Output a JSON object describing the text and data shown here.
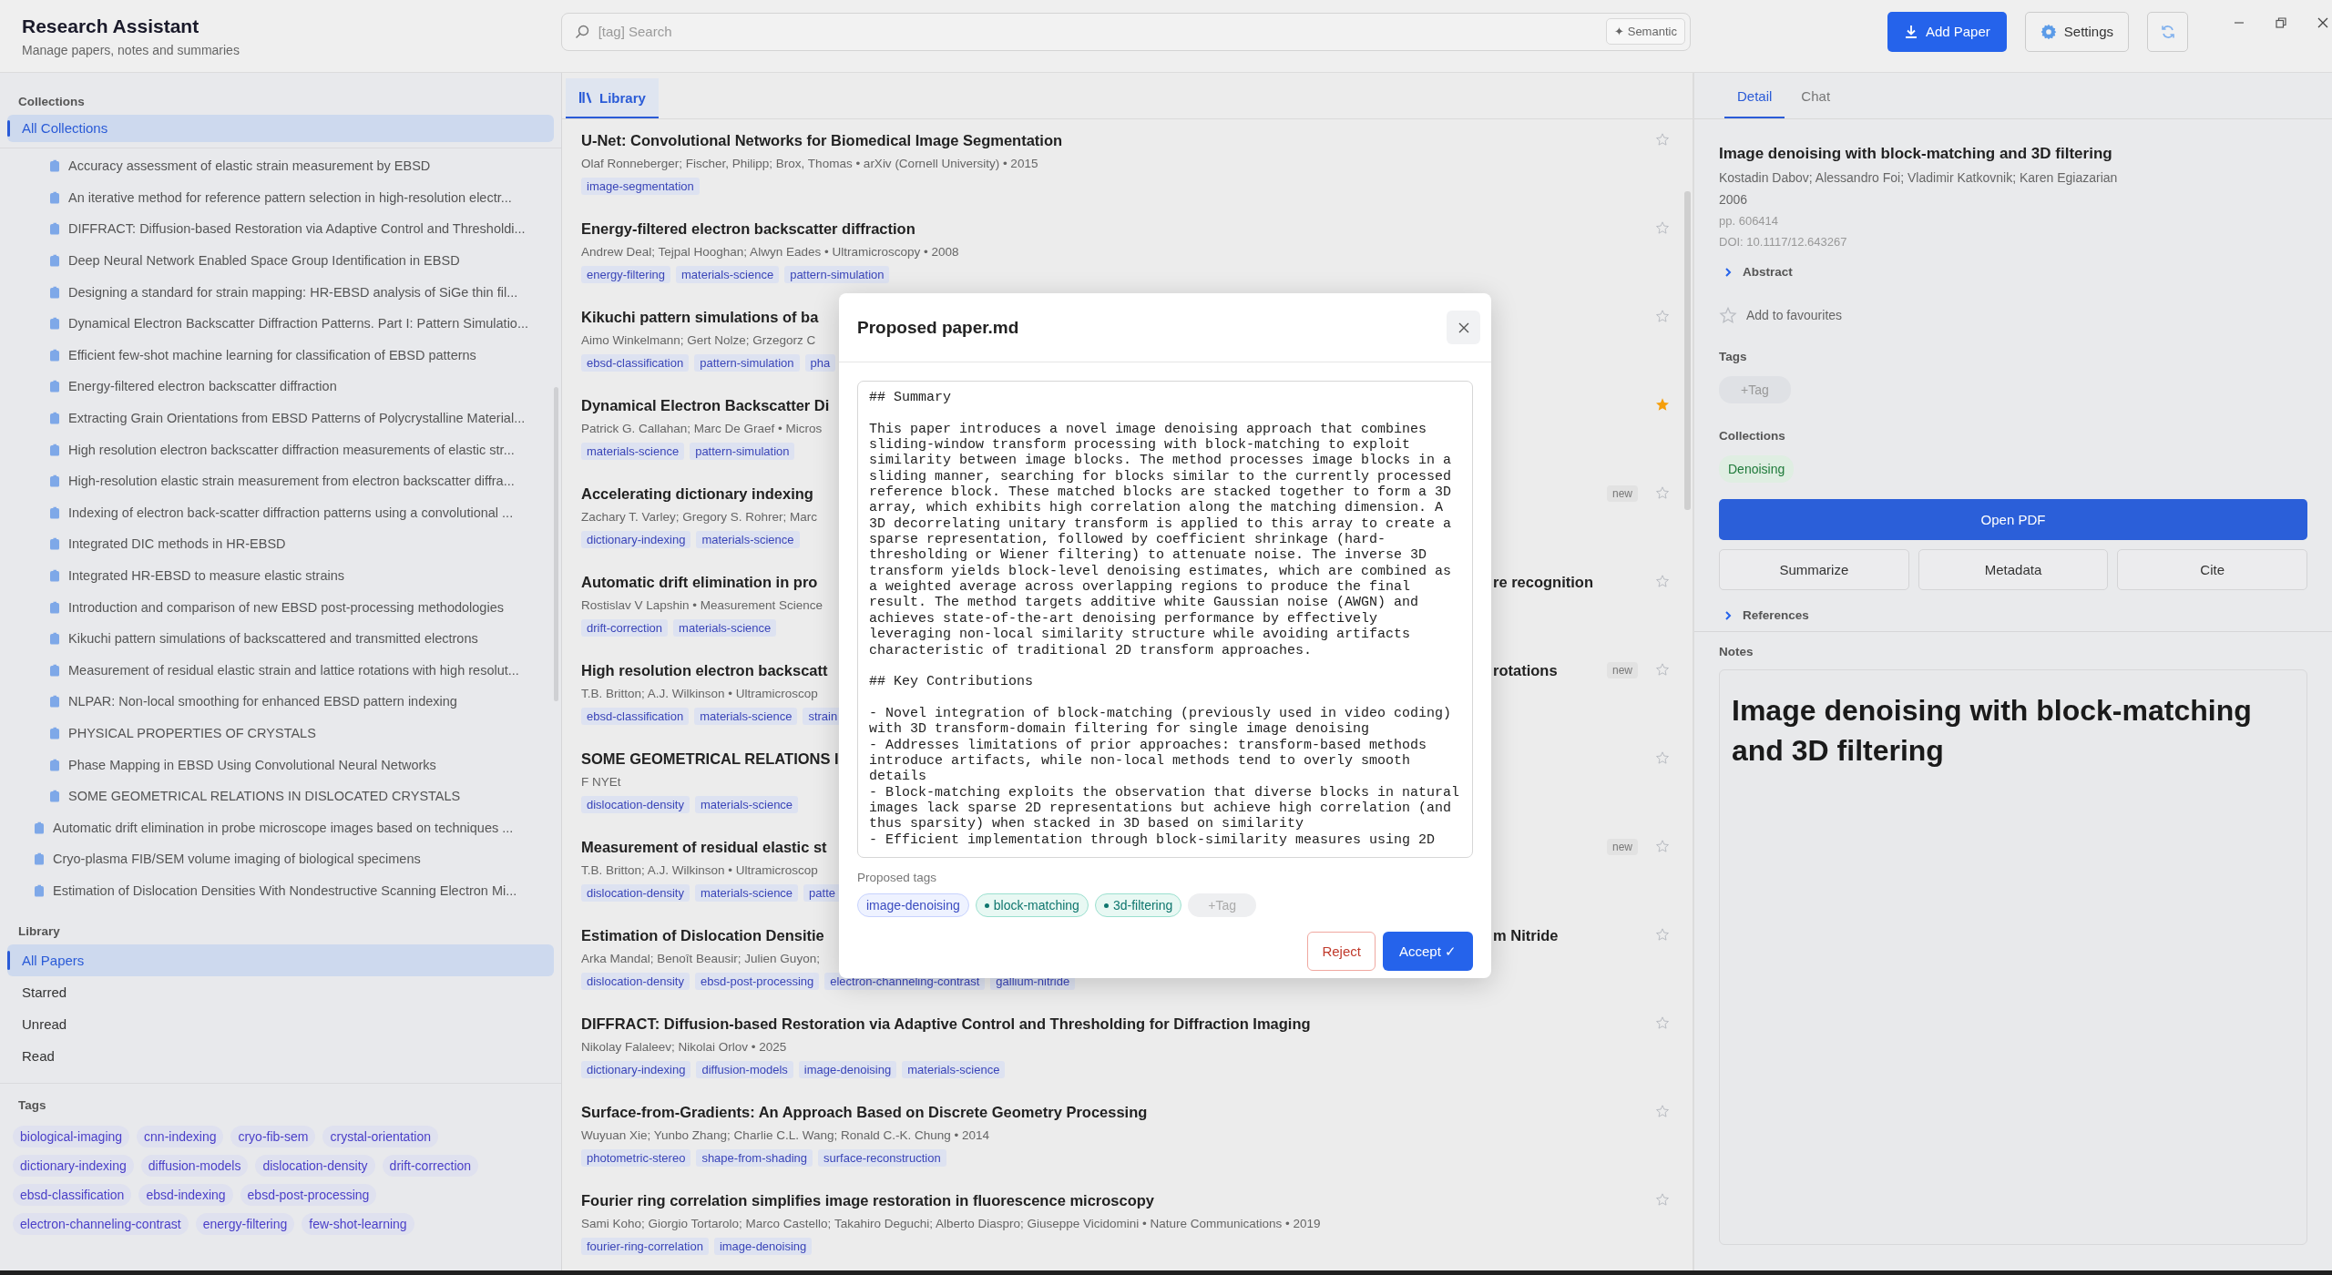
{
  "app": {
    "title": "Research Assistant",
    "subtitle": "Manage papers, notes and summaries"
  },
  "search": {
    "placeholder": "[tag] Search",
    "mode_button": "✦ Semantic"
  },
  "toolbar": {
    "add_paper": "Add Paper",
    "settings": "Settings"
  },
  "sidebar": {
    "collections_heading": "Collections",
    "all_collections": {
      "label": "All Collections",
      "selected": true
    },
    "collection_tree": [
      {
        "children": [
          {
            "label": "Accuracy assessment of elastic strain measurement by EBSD"
          },
          {
            "label": "An iterative method for reference pattern selection in high-resolution electr..."
          },
          {
            "label": "DIFFRACT: Diffusion-based Restoration via Adaptive Control and Thresholdi..."
          },
          {
            "label": "Deep Neural Network Enabled Space Group Identification in EBSD"
          },
          {
            "label": "Designing a standard for strain mapping: HR-EBSD analysis of SiGe thin fil..."
          },
          {
            "label": "Dynamical Electron Backscatter Diffraction Patterns. Part I: Pattern Simulatio..."
          },
          {
            "label": "Efficient few-shot machine learning for classification of EBSD patterns"
          },
          {
            "label": "Energy-filtered electron backscatter diffraction"
          },
          {
            "label": "Extracting Grain Orientations from EBSD Patterns of Polycrystalline Material..."
          },
          {
            "label": "High resolution electron backscatter diffraction measurements of elastic str..."
          },
          {
            "label": "High-resolution elastic strain measurement from electron backscatter diffra..."
          },
          {
            "label": "Indexing of electron back-scatter diffraction patterns using a convolutional ..."
          },
          {
            "label": "Integrated DIC methods in HR-EBSD"
          },
          {
            "label": "Integrated HR-EBSD to measure elastic strains"
          },
          {
            "label": "Introduction and comparison of new EBSD post-processing methodologies"
          },
          {
            "label": "Kikuchi pattern simulations of backscattered and transmitted electrons"
          },
          {
            "label": "Measurement of residual elastic strain and lattice rotations with high resolut..."
          },
          {
            "label": "NLPAR: Non-local smoothing for enhanced EBSD pattern indexing"
          },
          {
            "label": "PHYSICAL PROPERTIES OF CRYSTALS"
          },
          {
            "label": "Phase Mapping in EBSD Using Convolutional Neural Networks"
          },
          {
            "label": "SOME GEOMETRICAL RELATIONS IN DISLOCATED CRYSTALS"
          }
        ]
      },
      {
        "label": "Automatic drift elimination in probe microscope images based on techniques ..."
      },
      {
        "label": "Cryo-plasma FIB/SEM volume imaging of biological specimens"
      },
      {
        "label": "Estimation of Dislocation Densities With Nondestructive Scanning Electron Mi..."
      }
    ],
    "library_heading": "Library",
    "library_items": [
      {
        "label": "All Papers",
        "selected": true
      },
      {
        "label": "Starred",
        "selected": false
      },
      {
        "label": "Unread",
        "selected": false
      },
      {
        "label": "Read",
        "selected": false
      }
    ],
    "tags_heading": "Tags",
    "tags": [
      "biological-imaging",
      "cnn-indexing",
      "cryo-fib-sem",
      "crystal-orientation",
      "dictionary-indexing",
      "diffusion-models",
      "dislocation-density",
      "drift-correction",
      "ebsd-classification",
      "ebsd-indexing",
      "ebsd-post-processing",
      "electron-channeling-contrast",
      "energy-filtering",
      "few-shot-learning"
    ]
  },
  "library_tab": {
    "label": "Library",
    "selected": true
  },
  "papers": [
    {
      "title": "U-Net: Convolutional Networks for Biomedical Image Segmentation",
      "meta": "Olaf Ronneberger; Fischer, Philipp; Brox, Thomas • arXiv (Cornell University) • 2015",
      "tags": [
        "image-segmentation"
      ],
      "starred": false
    },
    {
      "title": "Energy-filtered electron backscatter diffraction",
      "meta": "Andrew Deal; Tejpal Hooghan; Alwyn Eades • Ultramicroscopy • 2008",
      "tags": [
        "energy-filtering",
        "materials-science",
        "pattern-simulation"
      ],
      "starred": false
    },
    {
      "title": "Kikuchi pattern simulations of ba",
      "meta": "Aimo Winkelmann; Gert Nolze; Grzegorz C",
      "tags": [
        "ebsd-classification",
        "pattern-simulation",
        "pha"
      ],
      "starred": false
    },
    {
      "title": "Dynamical Electron Backscatter Di",
      "meta": "Patrick G. Callahan; Marc De Graef • Micros",
      "tags": [
        "materials-science",
        "pattern-simulation"
      ],
      "starred": true
    },
    {
      "title": "Accelerating dictionary indexing",
      "meta": "Zachary T. Varley; Gregory S. Rohrer; Marc",
      "tags": [
        "dictionary-indexing",
        "materials-science"
      ],
      "badge": "new",
      "starred": false
    },
    {
      "title": "Automatic drift elimination in pro",
      "title_tail": "re recognition",
      "meta": "Rostislav V Lapshin • Measurement Science",
      "tags": [
        "drift-correction",
        "materials-science"
      ],
      "starred": false
    },
    {
      "title": "High resolution electron backscatt",
      "title_tail": "rotations",
      "meta": "T.B. Britton; A.J. Wilkinson • Ultramicroscop",
      "tags": [
        "ebsd-classification",
        "materials-science",
        "strain"
      ],
      "badge": "new",
      "starred": false
    },
    {
      "title": "SOME GEOMETRICAL RELATIONS I",
      "meta": "F NYEt",
      "tags": [
        "dislocation-density",
        "materials-science"
      ],
      "starred": false
    },
    {
      "title": "Measurement of residual elastic st",
      "meta": "T.B. Britton; A.J. Wilkinson • Ultramicroscop",
      "tags": [
        "dislocation-density",
        "materials-science",
        "patte"
      ],
      "badge": "new",
      "starred": false
    },
    {
      "title": "Estimation of Dislocation Densitie",
      "title_tail": "m Nitride",
      "meta": "Arka Mandal; Benoît Beausir; Julien Guyon;",
      "tags": [
        "dislocation-density",
        "ebsd-post-processing",
        "electron-channeling-contrast",
        "gallium-nitride"
      ],
      "starred": false
    },
    {
      "title": "DIFFRACT: Diffusion-based Restoration via Adaptive Control and Thresholding for Diffraction Imaging",
      "meta": "Nikolay Falaleev; Nikolai Orlov • 2025",
      "tags": [
        "dictionary-indexing",
        "diffusion-models",
        "image-denoising",
        "materials-science"
      ],
      "starred": false
    },
    {
      "title": "Surface-from-Gradients: An Approach Based on Discrete Geometry Processing",
      "meta": "Wuyuan Xie; Yunbo Zhang; Charlie C.L. Wang; Ronald C.-K. Chung • 2014",
      "tags": [
        "photometric-stereo",
        "shape-from-shading",
        "surface-reconstruction"
      ],
      "starred": false
    },
    {
      "title": "Fourier ring correlation simplifies image restoration in fluorescence microscopy",
      "meta": "Sami Koho; Giorgio Tortarolo; Marco Castello; Takahiro Deguchi; Alberto Diaspro; Giuseppe Vicidomini • Nature Communications • 2019",
      "tags": [
        "fourier-ring-correlation",
        "image-denoising"
      ],
      "starred": false
    }
  ],
  "modal": {
    "title": "Proposed paper.md",
    "content": "## Summary\n\nThis paper introduces a novel image denoising approach that combines sliding-window transform processing with block-matching to exploit similarity between image blocks. The method processes image blocks in a sliding manner, searching for blocks similar to the currently processed reference block. These matched blocks are stacked together to form a 3D array, which exhibits high correlation along the matching dimension. A 3D decorrelating unitary transform is applied to this array to create a sparse representation, followed by coefficient shrinkage (hard-thresholding or Wiener filtering) to attenuate noise. The inverse 3D transform yields block-level denoising estimates, which are combined as a weighted average across overlapping regions to produce the final result. The method targets additive white Gaussian noise (AWGN) and achieves state-of-the-art denoising performance by effectively leveraging non-local similarity structure while avoiding artifacts characteristic of traditional 2D transform approaches.\n\n## Key Contributions\n\n- Novel integration of block-matching (previously used in video coding) with 3D transform-domain filtering for single image denoising\n- Addresses limitations of prior approaches: transform-based methods introduce artifacts, while non-local methods tend to overly smooth details\n- Block-matching exploits the observation that diverse blocks in natural images lack sparse 2D representations but achieve high correlation (and thus sparsity) when stacked in 3D based on similarity\n- Efficient implementation through block-similarity measures using 2D",
    "tags_heading": "Proposed tags",
    "tags": [
      {
        "label": "image-denoising",
        "new": false
      },
      {
        "label": "block-matching",
        "new": true
      },
      {
        "label": "3d-filtering",
        "new": true
      }
    ],
    "add_tag": "+Tag",
    "reject": "Reject",
    "accept": "Accept ✓"
  },
  "detail": {
    "tabs": [
      {
        "label": "Detail",
        "selected": true
      },
      {
        "label": "Chat",
        "selected": false
      }
    ],
    "title": "Image denoising with block-matching and 3D filtering",
    "authors": "Kostadin Dabov; Alessandro Foi; Vladimir Katkovnik; Karen Egiazarian",
    "year": "2006",
    "pages": "pp. 606414",
    "doi": "DOI: 10.1117/12.643267",
    "abstract": {
      "label": "Abstract",
      "expanded": false
    },
    "favourite": {
      "label": "Add to favourites",
      "starred": false
    },
    "tags_heading": "Tags",
    "add_tag": "+Tag",
    "collections_heading": "Collections",
    "collections": [
      "Denoising"
    ],
    "open_pdf": "Open PDF",
    "actions": [
      "Summarize",
      "Metadata",
      "Cite"
    ],
    "references": {
      "label": "References",
      "expanded": false
    },
    "notes_heading": "Notes",
    "notes_title": "Image denoising with block-matching and 3D filtering"
  }
}
